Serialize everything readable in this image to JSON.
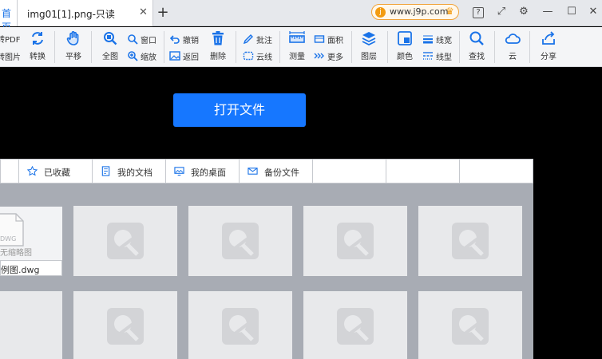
{
  "tabbar": {
    "home_label": "首页",
    "file_tab_title": "img01[1].png-只读",
    "close_glyph": "✕",
    "new_tab_glyph": "+",
    "site_url": "www.j9p.com",
    "site_logo_letter": "j"
  },
  "window": {
    "help_glyph": "?",
    "fullscreen_glyph": "⤢",
    "settings_glyph": "⚙",
    "minimize_glyph": "—",
    "maximize_glyph": "☐",
    "close_glyph": "✕"
  },
  "toolbar": {
    "to_pdf": "转PDF",
    "to_image": "转图片",
    "convert": "转换",
    "pan": "平移",
    "full_view": "全图",
    "window": "窗口",
    "zoom": "缩放",
    "undo": "撤销",
    "back": "返回",
    "delete": "删除",
    "annotate": "批注",
    "cloud_line": "云线",
    "measure": "测量",
    "area": "面积",
    "more": "更多",
    "layer": "图层",
    "color": "颜色",
    "line_width": "线宽",
    "line_type": "线型",
    "find": "查找",
    "cloud": "云",
    "share": "分享"
  },
  "canvas": {
    "open_file_label": "打开文件"
  },
  "panel": {
    "tabs": [
      {
        "label": "已收藏",
        "icon": "star-icon"
      },
      {
        "label": "我的文档",
        "icon": "document-icon"
      },
      {
        "label": "我的桌面",
        "icon": "desktop-icon"
      },
      {
        "label": "备份文件",
        "icon": "mail-icon"
      }
    ],
    "first_file": {
      "doc_badge": "DWG",
      "no_thumbnail": "无缩略图",
      "name": "例图.dwg"
    }
  },
  "colors": {
    "accent": "#1677ff",
    "canvas_bg": "#000000",
    "panel_bg": "#a8acb4"
  }
}
